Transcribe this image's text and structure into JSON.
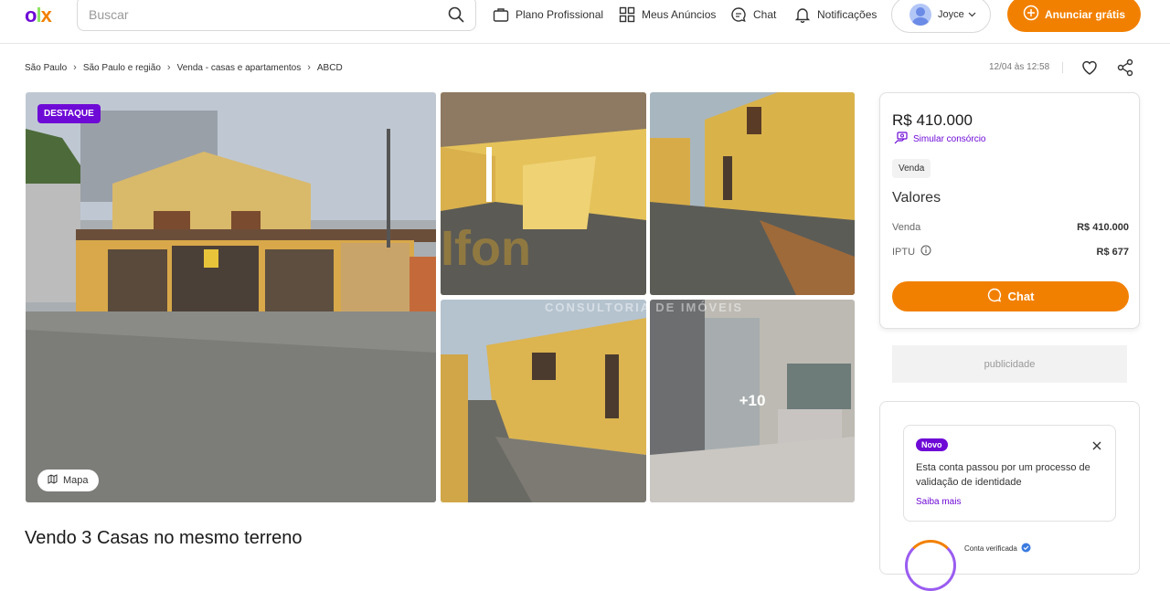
{
  "header": {
    "logo": {
      "o": "o",
      "l": "l",
      "x": "x"
    },
    "search_placeholder": "Buscar",
    "nav": {
      "plano": "Plano Profissional",
      "anuncios": "Meus Anúncios",
      "chat": "Chat",
      "notificacoes": "Notificações"
    },
    "user_name": "Joyce",
    "anunciar": "Anunciar grátis"
  },
  "breadcrumb": [
    "São Paulo",
    "São Paulo e região",
    "Venda - casas e apartamentos",
    "ABCD"
  ],
  "timestamp": "12/04 às 12:58",
  "gallery": {
    "badge": "DESTAQUE",
    "mapa": "Mapa",
    "more_photos": "+10",
    "watermark": "Ifon",
    "watermark_sub": "CONSULTORIA DE IMÓVEIS"
  },
  "listing_title": "Vendo 3 Casas no mesmo terreno",
  "price_card": {
    "price": "R$ 410.000",
    "simular": "Simular consórcio",
    "tag": "Venda",
    "valores_title": "Valores",
    "rows": [
      {
        "label": "Venda",
        "value": "R$ 410.000"
      },
      {
        "label": "IPTU",
        "value": "R$ 677"
      }
    ],
    "chat_button": "Chat"
  },
  "publicidade": "publicidade",
  "account_card": {
    "novo": "Novo",
    "verify_text": "Esta conta passou por um processo de validação de identidade",
    "saiba_mais": "Saiba mais",
    "conta_verificada": "Conta verificada"
  },
  "colors": {
    "brand_purple": "#6e0ad6",
    "brand_orange": "#f28000",
    "brand_green": "#8ce563"
  }
}
